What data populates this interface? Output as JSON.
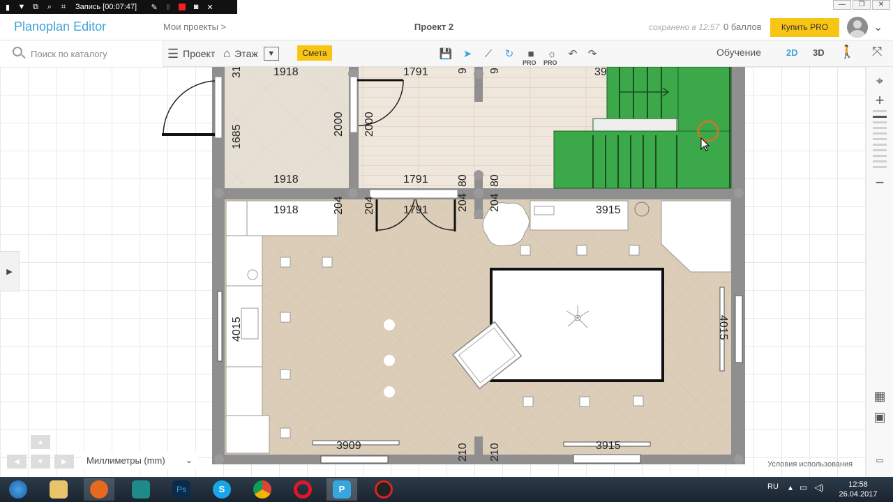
{
  "recorder": {
    "label": "Запись [00:07:47]"
  },
  "header": {
    "logo": "Planoplan Editor",
    "breadcrumb": "Мои проекты >",
    "project_title": "Проект 2",
    "saved": "сохранено в 12:57",
    "score": "0 баллов",
    "buy_pro": "Купить PRO"
  },
  "search": {
    "placeholder": "Поиск по каталогу"
  },
  "toolbar": {
    "project": "Проект",
    "floor": "Этаж",
    "smeta": "Смета",
    "pro1": "PRO",
    "pro2": "PRO",
    "learn": "Обучение",
    "view2d": "2D",
    "view3d": "3D"
  },
  "plan": {
    "dims": [
      "1918",
      "1791",
      "1918",
      "1791",
      "1918",
      "1791",
      "1685",
      "2000",
      "2000",
      "204",
      "204",
      "80",
      "80",
      "204",
      "204",
      "3915",
      "4015",
      "4015",
      "3909",
      "3915",
      "210",
      "210",
      "31",
      "9",
      "9",
      "39"
    ]
  },
  "footer": {
    "units": "Миллиметры (mm)",
    "terms": "Условия использования"
  },
  "taskbar": {
    "lang": "RU",
    "time": "12:58",
    "date": "26.04.2017"
  }
}
